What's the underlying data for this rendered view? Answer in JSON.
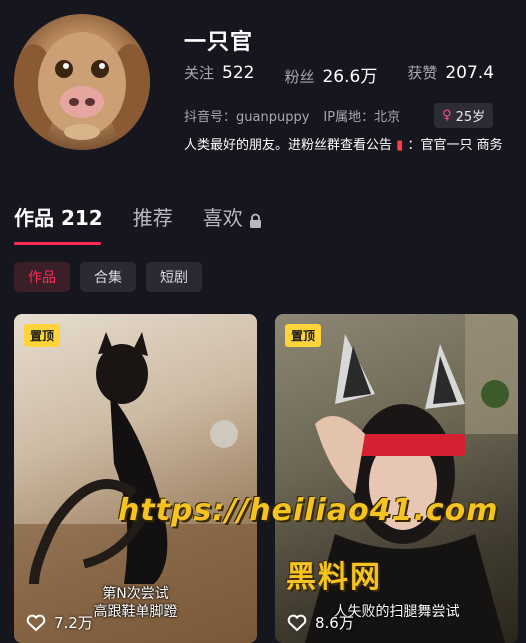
{
  "profile": {
    "name": "一只官",
    "avatar_icon": "dog-avatar",
    "stats": [
      {
        "label": "关注",
        "value": "522"
      },
      {
        "label": "粉丝",
        "value": "26.6万"
      },
      {
        "label": "获赞",
        "value": "207.4"
      }
    ],
    "douyin_id": "抖音号：guanpuppy",
    "ip_location": "IP属地：北京",
    "age_symbol": "♀",
    "age": "25岁",
    "bio_text": "人类最好的朋友。进粉丝群查看公告",
    "bio_flag": "▮",
    "bio_tail": "：官官一只 商务"
  },
  "tabs": [
    {
      "label": "作品 212",
      "active": true
    },
    {
      "label": "推荐",
      "active": false
    },
    {
      "label": "喜欢",
      "active": false
    }
  ],
  "chips": [
    {
      "label": "作品",
      "active": true
    },
    {
      "label": "合集",
      "active": false
    },
    {
      "label": "短剧",
      "active": false
    }
  ],
  "videos": [
    {
      "pinned_label": "置顶",
      "caption_line1": "第N次尝试",
      "caption_line2": "高跟鞋单脚蹬",
      "likes": "7.2万"
    },
    {
      "pinned_label": "置顶",
      "caption_line1": "",
      "caption_line2": "人失败的扫腿舞尝试",
      "likes": "8.6万"
    }
  ],
  "watermark": {
    "url": "https://heiliao41.com",
    "text": "黑料网"
  },
  "colors": {
    "accent": "#fe2c55",
    "background": "#16161e",
    "pin": "#ffd43b",
    "watermark": "#f5c322"
  }
}
